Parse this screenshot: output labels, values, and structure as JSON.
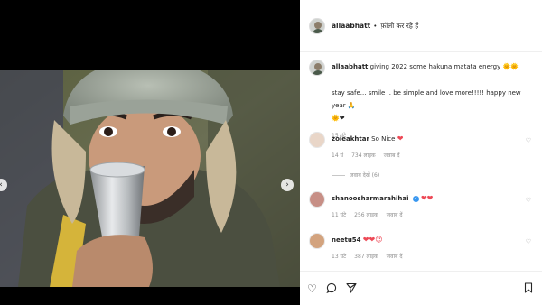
{
  "post": {
    "username": "allaabhatt",
    "header_status": "फ़ॉलो कर रहे हैं",
    "caption_username": "allaabhatt",
    "caption_line1": "giving 2022 some hakuna matata energy 🌞🌞",
    "caption_line2": "stay safe... smile .. be simple and love more!!!!! happy new year 🙏",
    "caption_line3": "🌞❤",
    "caption_time": "15 घंटे"
  },
  "comments": [
    {
      "username": "zoieakhtar",
      "text": "So Nice",
      "emoji": "❤",
      "time": "14 घं",
      "likes": "734 लाइक",
      "reply": "जवाब दें"
    },
    {
      "username": "shanoosharmarahihai",
      "text": "",
      "emoji": "❤❤",
      "time": "11 घंटे",
      "likes": "256 लाइक",
      "reply": "जवाब दें"
    },
    {
      "username": "neetu54",
      "text": "",
      "emoji": "❤❤😍",
      "time": "13 घंटे",
      "likes": "387 लाइक",
      "reply": "जवाब दें"
    }
  ],
  "view_replies": "जवाब देखें (6)",
  "icons": {
    "like": "heart-outline-icon",
    "comment": "comment-icon",
    "share": "send-icon",
    "save": "bookmark-icon",
    "next": "chevron-right-icon",
    "prev": "chevron-left-icon"
  },
  "colors": {
    "verified": "#3897f0",
    "heart": "#ed4956",
    "text": "#262626",
    "muted": "#8e8e8e"
  }
}
